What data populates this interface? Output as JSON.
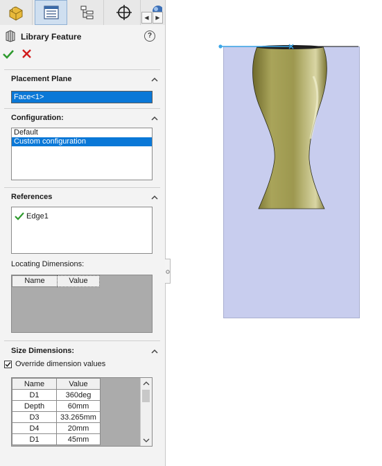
{
  "tabs": [
    {
      "name": "featuremanager",
      "icon": "part-icon"
    },
    {
      "name": "propertymanager",
      "icon": "property-manager-icon"
    },
    {
      "name": "configurationmanager",
      "icon": "configuration-icon"
    },
    {
      "name": "dimxpert",
      "icon": "crosshair-icon"
    },
    {
      "name": "display",
      "icon": "appearance-icon"
    }
  ],
  "feature": {
    "title": "Library Feature",
    "help": "?"
  },
  "placement": {
    "title": "Placement Plane",
    "value": "Face<1>"
  },
  "configuration": {
    "title": "Configuration:",
    "items": [
      "Default",
      "Custom configuration"
    ],
    "selected": "Custom configuration"
  },
  "references": {
    "title": "References",
    "items": [
      "Edge1"
    ]
  },
  "locating": {
    "title": "Locating Dimensions:",
    "columns": [
      "Name",
      "Value"
    ]
  },
  "size": {
    "title": "Size Dimensions:",
    "override_label": "Override dimension values",
    "override_checked": true,
    "columns": [
      "Name",
      "Value"
    ],
    "rows": [
      {
        "name": "D1",
        "value": "360deg"
      },
      {
        "name": "Depth",
        "value": "60mm"
      },
      {
        "name": "D3",
        "value": "33.265mm"
      },
      {
        "name": "D4",
        "value": "20mm"
      },
      {
        "name": "D1",
        "value": "45mm"
      }
    ]
  },
  "colors": {
    "accent": "#0a78d7",
    "plane": "#c8cdee",
    "vase": "#a8a35a",
    "ok": "#2e9a2e",
    "cancel": "#d11b1b"
  }
}
